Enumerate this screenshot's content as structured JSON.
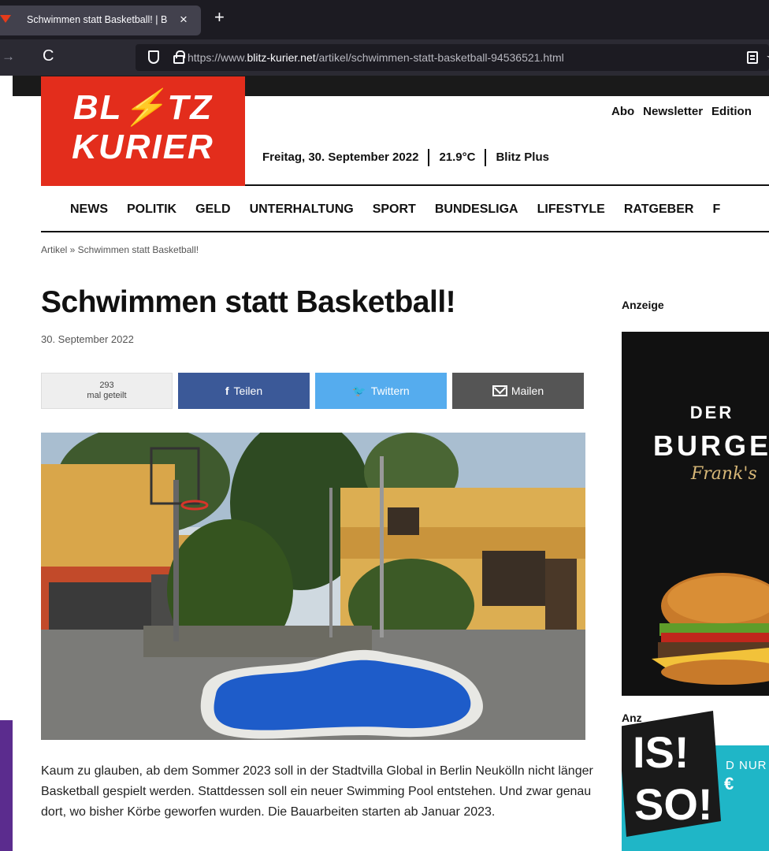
{
  "browser": {
    "tab_title": "Schwimmen statt Basketball! | B",
    "tab_close": "×",
    "new_tab": "+",
    "back": "→",
    "reload": "C",
    "url_prefix": "https://www.",
    "url_domain": "blitz-kurier.net",
    "url_path": "/artikel/schwimmen-statt-basketball-94536521.html",
    "bookmark": "☆"
  },
  "site": {
    "logo_line1_a": "BL",
    "logo_bolt": "⚡",
    "logo_line1_b": "TZ",
    "logo_line2": "KURIER",
    "top_links": [
      "Abo",
      "Newsletter",
      "Edition"
    ],
    "date": "Freitag, 30. September 2022",
    "temperature": "21.9°C",
    "plus": "Blitz Plus",
    "nav": [
      "NEWS",
      "POLITIK",
      "GELD",
      "UNTERHALTUNG",
      "SPORT",
      "BUNDESLIGA",
      "LIFESTYLE",
      "RATGEBER",
      "F"
    ]
  },
  "article": {
    "breadcrumb": "Artikel » Schwimmen statt Basketball!",
    "headline": "Schwimmen statt Basketball!",
    "date": "30. September 2022",
    "share_count": "293",
    "share_count_label": "mal geteilt",
    "share_facebook": "Teilen",
    "share_twitter": "Twittern",
    "share_mail": "Mailen",
    "body": "Kaum zu glauben, ab dem Sommer 2023 soll in der Stadtvilla Global in Berlin Neukölln nicht länger Basketball gespielt werden. Stattdessen soll ein neuer Swimming Pool entstehen. Und zwar genau dort, wo bisher Körbe geworfen wurden. Die Bauarbeiten starten ab Januar 2023."
  },
  "sidebar": {
    "ad_label": "Anzeige",
    "ad1_line1": "DER",
    "ad1_line2": "BURGE",
    "ad1_line3": "Frank's",
    "ad2_label": "Anz",
    "ad2_logo_top": "IS!",
    "ad2_logo_bottom": "SO!",
    "ad2_nur": "D NUR",
    "ad2_price": "€"
  },
  "colors": {
    "brand_red": "#e32d1c",
    "bolt_yellow": "#ffcb05",
    "facebook": "#3b5998",
    "twitter": "#55acee",
    "mail": "#555555"
  }
}
